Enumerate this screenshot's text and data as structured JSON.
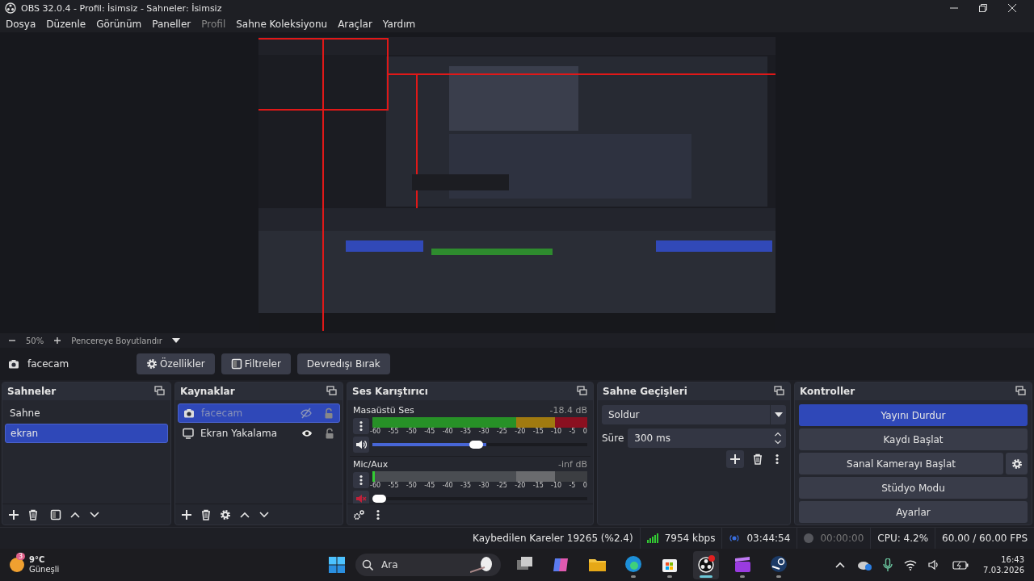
{
  "window": {
    "title": "OBS 32.0.4 - Profil: İsimsiz - Sahneler: İsimsiz"
  },
  "menu": [
    {
      "label": "Dosya",
      "disabled": false
    },
    {
      "label": "Düzenle",
      "disabled": false
    },
    {
      "label": "Görünüm",
      "disabled": false
    },
    {
      "label": "Paneller",
      "disabled": false
    },
    {
      "label": "Profil",
      "disabled": true
    },
    {
      "label": "Sahne Koleksiyonu",
      "disabled": false
    },
    {
      "label": "Araçlar",
      "disabled": false
    },
    {
      "label": "Yardım",
      "disabled": false
    }
  ],
  "zoom_bar": {
    "zoom": "50%",
    "mode": "Pencereye Boyutlandır"
  },
  "source_toolbar": {
    "source": "facecam",
    "buttons": [
      {
        "label": "Özellikler",
        "kind": "gear"
      },
      {
        "label": "Filtreler",
        "kind": "filter"
      },
      {
        "label": "Devredışı Bırak",
        "kind": "plain"
      }
    ]
  },
  "scenes": {
    "title": "Sahneler",
    "items": [
      {
        "label": "Sahne",
        "selected": false
      },
      {
        "label": "ekran",
        "selected": true
      }
    ]
  },
  "sources": {
    "title": "Kaynaklar",
    "items": [
      {
        "label": "facecam",
        "kind": "camera",
        "selected": true,
        "visible": false,
        "locked": false
      },
      {
        "label": "Ekran Yakalama",
        "kind": "display",
        "selected": false,
        "visible": true,
        "locked": false
      }
    ]
  },
  "mixer": {
    "title": "Ses Karıştırıcı",
    "channels": [
      {
        "name": "Masaüstü Ses",
        "reading": "-18.4 dB",
        "muted": false,
        "level": 0.53,
        "scale": [
          "-60",
          "-55",
          "-50",
          "-45",
          "-40",
          "-35",
          "-30",
          "-25",
          "-20",
          "-15",
          "-10",
          "-5",
          "0"
        ]
      },
      {
        "name": "Mic/Aux",
        "reading": "-inf dB",
        "muted": true,
        "level": 0.0,
        "scale": [
          "-60",
          "-55",
          "-50",
          "-45",
          "-40",
          "-35",
          "-30",
          "-25",
          "-20",
          "-15",
          "-10",
          "-5",
          "0"
        ]
      }
    ]
  },
  "transitions": {
    "title": "Sahne Geçişleri",
    "transition": "Soldur",
    "duration_label": "Süre",
    "duration": "300 ms"
  },
  "controls": {
    "title": "Kontroller",
    "buttons": [
      {
        "label": "Yayını Durdur",
        "active": true,
        "settings": false
      },
      {
        "label": "Kaydı Başlat",
        "active": false,
        "settings": false
      },
      {
        "label": "Sanal Kamerayı Başlat",
        "active": false,
        "settings": true
      },
      {
        "label": "Stüdyo Modu",
        "active": false,
        "settings": false
      },
      {
        "label": "Ayarlar",
        "active": false,
        "settings": false
      }
    ]
  },
  "status_bar": {
    "dropped": "Kaybedilen Kareler 19265 (%2.4)",
    "bitrate": "7954 kbps",
    "stream_time": "03:44:54",
    "streaming": true,
    "record_time": "00:00:00",
    "recording": false,
    "cpu": "CPU: 4.2%",
    "fps": "60.00 / 60.00 FPS"
  },
  "taskbar": {
    "weather": {
      "badge": "3",
      "temperature": "9°C",
      "condition": "Güneşli"
    },
    "search": {
      "placeholder": "Ara"
    },
    "apps": [
      {
        "kind": "taskview",
        "running": false,
        "active": false
      },
      {
        "kind": "copilot",
        "running": false,
        "active": false
      },
      {
        "kind": "folder",
        "running": false,
        "active": false
      },
      {
        "kind": "edge",
        "running": true,
        "active": false
      },
      {
        "kind": "store",
        "running": true,
        "active": false
      },
      {
        "kind": "obs",
        "running": true,
        "active": true
      },
      {
        "kind": "clapper",
        "running": true,
        "active": false
      },
      {
        "kind": "steam",
        "running": true,
        "active": false
      }
    ],
    "time": "16:43",
    "date": "7.03.2026"
  }
}
